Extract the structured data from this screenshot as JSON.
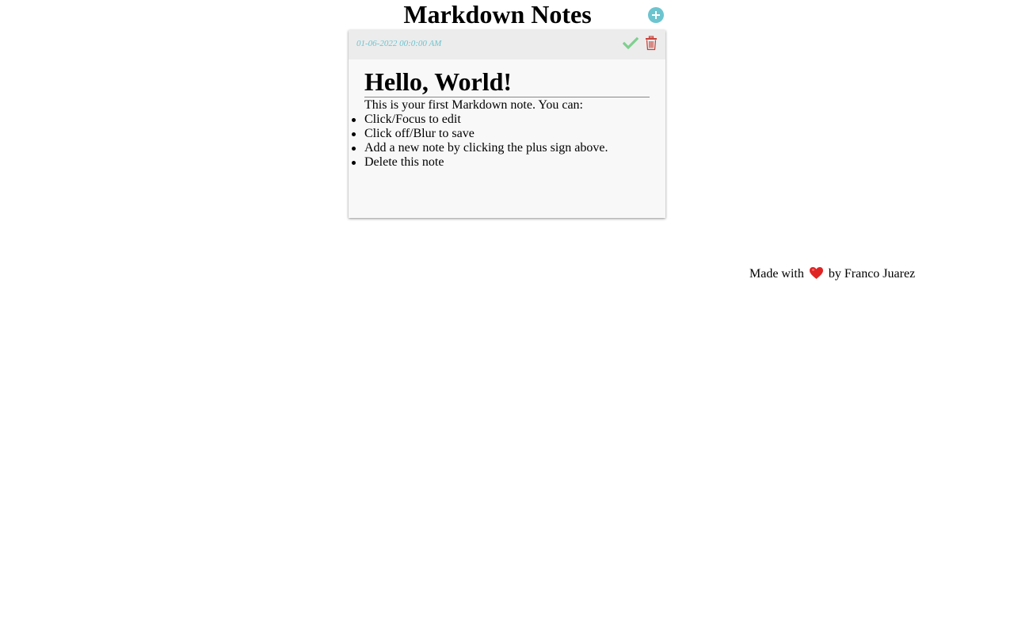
{
  "app": {
    "title": "Markdown Notes",
    "add_note_label": "Add note"
  },
  "note": {
    "timestamp": "01-06-2022 00:0:00 AM",
    "heading": "Hello, World!",
    "intro": "This is your first Markdown note. You can:",
    "items": [
      "Click/Focus to edit",
      "Click off/Blur to save",
      "Add a new note by clicking the plus sign above.",
      "Delete this note"
    ]
  },
  "footer": {
    "prefix": "Made with",
    "suffix": "by Franco Juarez"
  },
  "icons": {
    "add": "plus-circle-icon",
    "save": "check-icon",
    "delete": "trash-icon",
    "love": "heart-icon"
  },
  "colors": {
    "accent": "#6cc4cf",
    "save": "#7fcf8f",
    "delete": "#c9423a",
    "heart": "#e02424",
    "card_header": "#ececec",
    "card_body": "#f8f8f8"
  }
}
